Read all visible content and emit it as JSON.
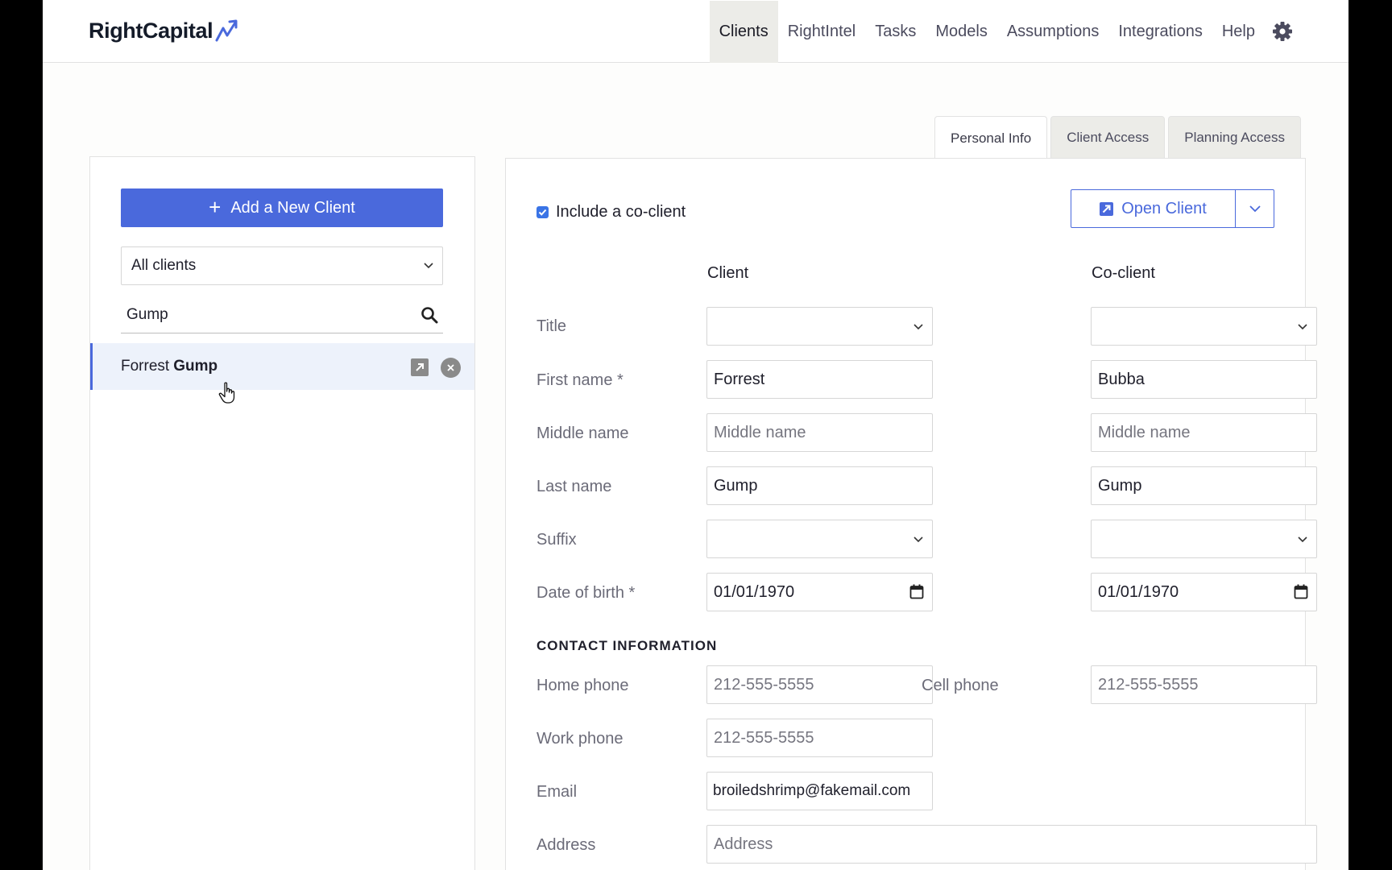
{
  "app": {
    "logo_text": "RightCapital",
    "brand_color": "#4a69dc"
  },
  "nav": {
    "items": [
      {
        "label": "Clients",
        "active": true
      },
      {
        "label": "RightIntel"
      },
      {
        "label": "Tasks"
      },
      {
        "label": "Models"
      },
      {
        "label": "Assumptions"
      },
      {
        "label": "Integrations"
      },
      {
        "label": "Help"
      }
    ],
    "settings_icon": "gear-icon"
  },
  "sidebar": {
    "add_button_label": "Add a New Client",
    "filter_value": "All clients",
    "search_value": "Gump",
    "results": [
      {
        "first": "Forrest",
        "last": "Gump"
      }
    ]
  },
  "tabs": [
    {
      "label": "Personal Info",
      "active": true
    },
    {
      "label": "Client Access"
    },
    {
      "label": "Planning Access"
    }
  ],
  "form": {
    "include_coclient_label": "Include a co-client",
    "include_coclient_checked": true,
    "open_client_label": "Open Client",
    "client_header": "Client",
    "coclient_header": "Co-client",
    "labels": {
      "title": "Title",
      "first_name": "First name *",
      "middle_name": "Middle name",
      "last_name": "Last name",
      "suffix": "Suffix",
      "dob": "Date of birth *",
      "home_phone": "Home phone",
      "cell_phone": "Cell phone",
      "work_phone": "Work phone",
      "email": "Email",
      "address": "Address"
    },
    "client": {
      "title": "",
      "first_name": "Forrest",
      "middle_name_placeholder": "Middle name",
      "last_name": "Gump",
      "suffix": "",
      "dob": "01/01/1970"
    },
    "coclient": {
      "title": "",
      "first_name": "Bubba",
      "middle_name_placeholder": "Middle name",
      "last_name": "Gump",
      "suffix": "",
      "dob": "01/01/1970"
    },
    "contact_section_title": "CONTACT INFORMATION",
    "contact": {
      "home_phone_placeholder": "212-555-5555",
      "cell_phone_placeholder": "212-555-5555",
      "work_phone_placeholder": "212-555-5555",
      "email": "broiledshrimp@fakemail.com",
      "address_placeholder": "Address"
    }
  }
}
